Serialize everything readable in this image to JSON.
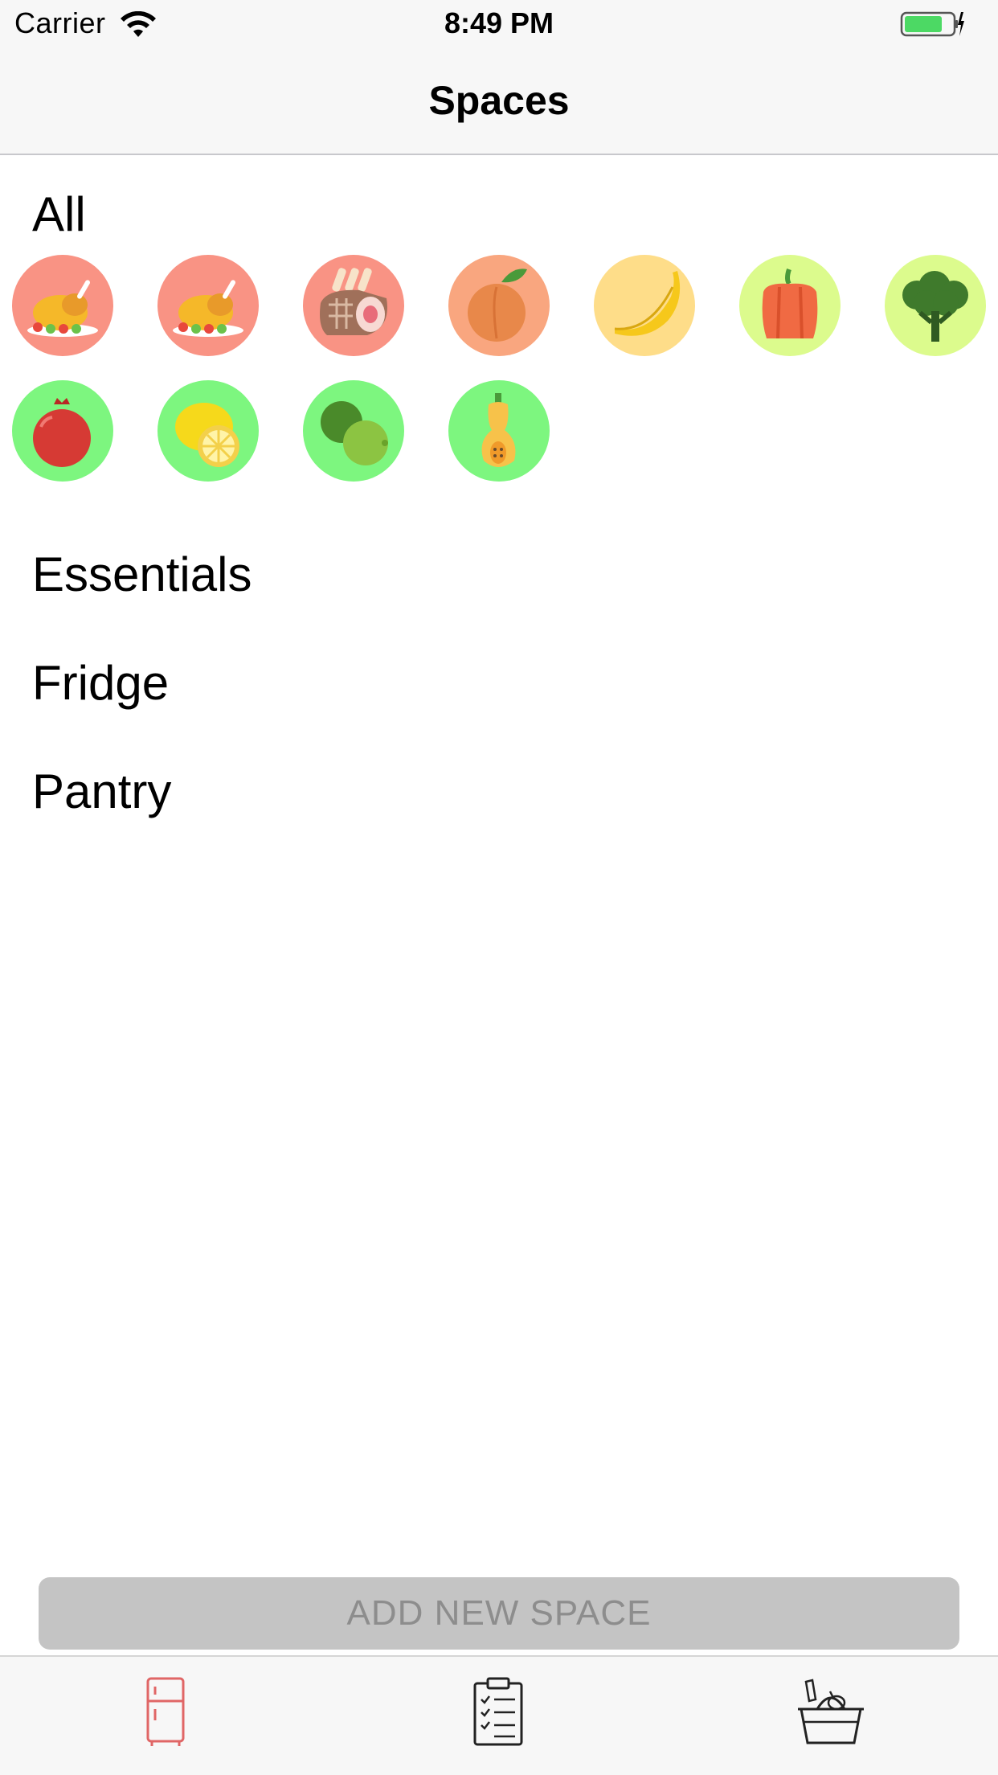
{
  "status_bar": {
    "carrier": "Carrier",
    "time": "8:49 PM",
    "icons": [
      "wifi-icon",
      "battery-icon",
      "charging-bolt-icon"
    ]
  },
  "nav": {
    "title": "Spaces"
  },
  "sections": [
    {
      "title": "All",
      "items": [
        {
          "icon": "roast-chicken-icon",
          "color": "#f99384"
        },
        {
          "icon": "roast-chicken-icon",
          "color": "#f99384"
        },
        {
          "icon": "rack-of-lamb-icon",
          "color": "#f99384"
        },
        {
          "icon": "peach-icon",
          "color": "#f9a67f"
        },
        {
          "icon": "banana-icon",
          "color": "#fedd89"
        },
        {
          "icon": "bell-pepper-icon",
          "color": "#dcfb8d"
        },
        {
          "icon": "broccoli-icon",
          "color": "#dcfb8d"
        },
        {
          "icon": "pomegranate-icon",
          "color": "#7df67f"
        },
        {
          "icon": "lemon-icon",
          "color": "#7df67f"
        },
        {
          "icon": "limes-icon",
          "color": "#7df67f"
        },
        {
          "icon": "butternut-squash-icon",
          "color": "#7df67f"
        }
      ]
    },
    {
      "title": "Essentials",
      "items": []
    },
    {
      "title": "Fridge",
      "items": []
    },
    {
      "title": "Pantry",
      "items": []
    }
  ],
  "add_button": {
    "label": "ADD NEW SPACE"
  },
  "tab_bar": {
    "tabs": [
      {
        "icon": "fridge-icon",
        "selected": true,
        "color": "#e06666"
      },
      {
        "icon": "clipboard-checklist-icon",
        "selected": false,
        "color": "#222222"
      },
      {
        "icon": "grocery-basket-icon",
        "selected": false,
        "color": "#222222"
      }
    ]
  }
}
